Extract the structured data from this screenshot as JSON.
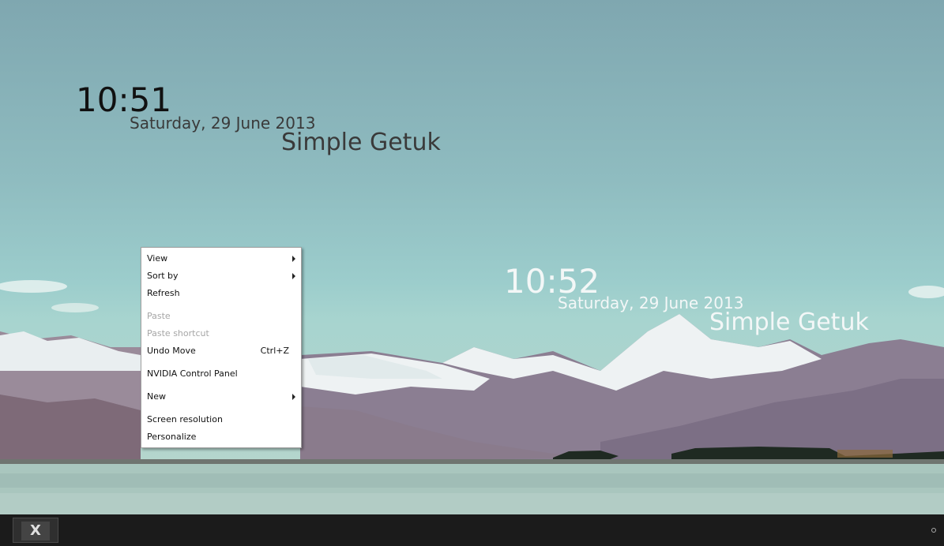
{
  "clock_widgets": [
    {
      "time": "10:51",
      "date": "Saturday, 29 June 2013",
      "name": "Simple Getuk"
    },
    {
      "time": "10:52",
      "date": "Saturday, 29 June 2013",
      "name": "Simple Getuk"
    }
  ],
  "context_menu": {
    "items": [
      {
        "label": "View",
        "submenu": true,
        "disabled": false
      },
      {
        "label": "Sort by",
        "submenu": true,
        "disabled": false
      },
      {
        "label": "Refresh",
        "disabled": false
      },
      {
        "label": "Paste",
        "disabled": true
      },
      {
        "label": "Paste shortcut",
        "disabled": true
      },
      {
        "label": "Undo Move",
        "shortcut": "Ctrl+Z",
        "disabled": false
      },
      {
        "label": "NVIDIA Control Panel",
        "disabled": false
      },
      {
        "label": "New",
        "submenu": true,
        "disabled": false
      },
      {
        "label": "Screen resolution",
        "disabled": false
      },
      {
        "label": "Personalize",
        "disabled": false
      }
    ]
  },
  "taskbar": {
    "start_label": "X"
  },
  "colors": {
    "taskbar": "#1b1b1b",
    "menu_background": "#ffffff",
    "menu_disabled_text": "#a6a6a6"
  }
}
